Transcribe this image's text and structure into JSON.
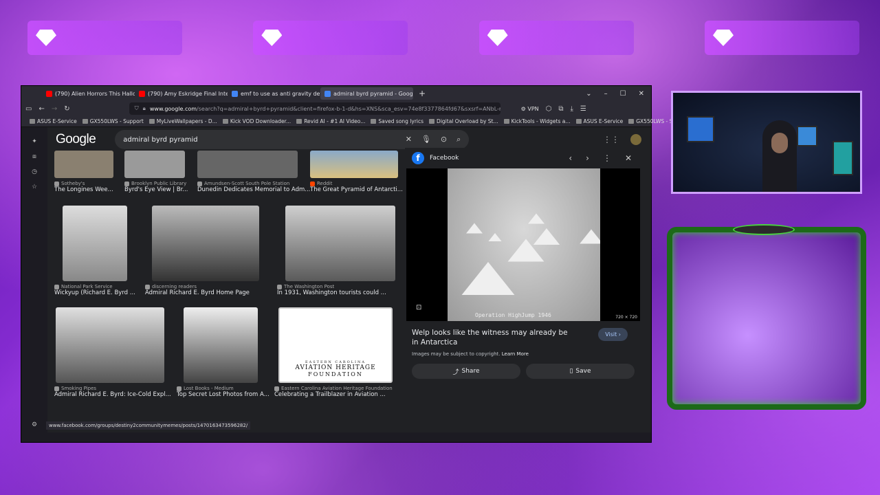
{
  "tabs": [
    {
      "title": "(790) Alien Horrors This Hallow",
      "color": "#ff0000",
      "active": false
    },
    {
      "title": "(790) Amy Eskridge Final Interv",
      "color": "#ff0000",
      "active": false
    },
    {
      "title": "emf to use as anti gravity devic",
      "color": "#4285f4",
      "active": false
    },
    {
      "title": "admiral byrd pyramid - Google",
      "color": "#4285f4",
      "active": true
    }
  ],
  "url": {
    "host": "www.google.com",
    "rest": "/search?q=admiral+byrd+pyramid&client=firefox-b-1-d&hs=XNS&sca_esv=74e8f3377864fd67&sxsrf=ANbL-n"
  },
  "vpn_label": "VPN",
  "bookmarks": [
    "ASUS E-Service",
    "GX550LWS - Support",
    "MyLiveWallpapers - D...",
    "Kick VOD Downloader...",
    "Revid AI - #1 AI Video...",
    "Saved song lyrics",
    "Digital Overload by St...",
    "KickTools - Widgets a...",
    "ASUS E-Service",
    "GX550LWS - Support"
  ],
  "google": {
    "logo": "Google",
    "query": "admiral byrd pyramid"
  },
  "results": [
    {
      "source": "Sotheby's",
      "title": "The Longines Wee..."
    },
    {
      "source": "Brooklyn Public Library",
      "title": "Byrd's Eye View | Br..."
    },
    {
      "source": "Amundsen-Scott South Pole Station",
      "title": "Dunedin Dedicates Memorial to Adm..."
    },
    {
      "source": "Reddit",
      "title": "The Great Pyramid of Antarcti..."
    },
    {
      "source": "National Park Service",
      "title": "Wickyup (Richard E. Byrd ..."
    },
    {
      "source": "discerning readers",
      "title": "Admiral Richard E. Byrd Home Page"
    },
    {
      "source": "The Washington Post",
      "title": "In 1931, Washington tourists could ..."
    },
    {
      "source": "Smoking Pipes",
      "title": "Admiral Richard E. Byrd: Ice-Cold Expl..."
    },
    {
      "source": "Lost Books - Medium",
      "title": "Top Secret Lost Photos from A..."
    },
    {
      "source": "Eastern Carolina Aviation Heritage Foundation",
      "title": "Celebrating a Trailblazer in Aviation ..."
    }
  ],
  "ecahf_logo": {
    "line1": "EASTERN CAROLINA",
    "line2": "AVIATION HERITAGE",
    "line3": "FOUNDATION"
  },
  "panel": {
    "source": "Facebook",
    "watermark": "Operation HighJump 1946",
    "dims": "720 × 720",
    "title": "Welp looks like the witness may already be in Antarctica",
    "visit": "Visit",
    "copyright": "Images may be subject to copyright.",
    "learn_more": "Learn More",
    "share": "Share",
    "save": "Save"
  },
  "statusbar": "www.facebook.com/groups/destiny2communitymemes/posts/1470163473596282/"
}
